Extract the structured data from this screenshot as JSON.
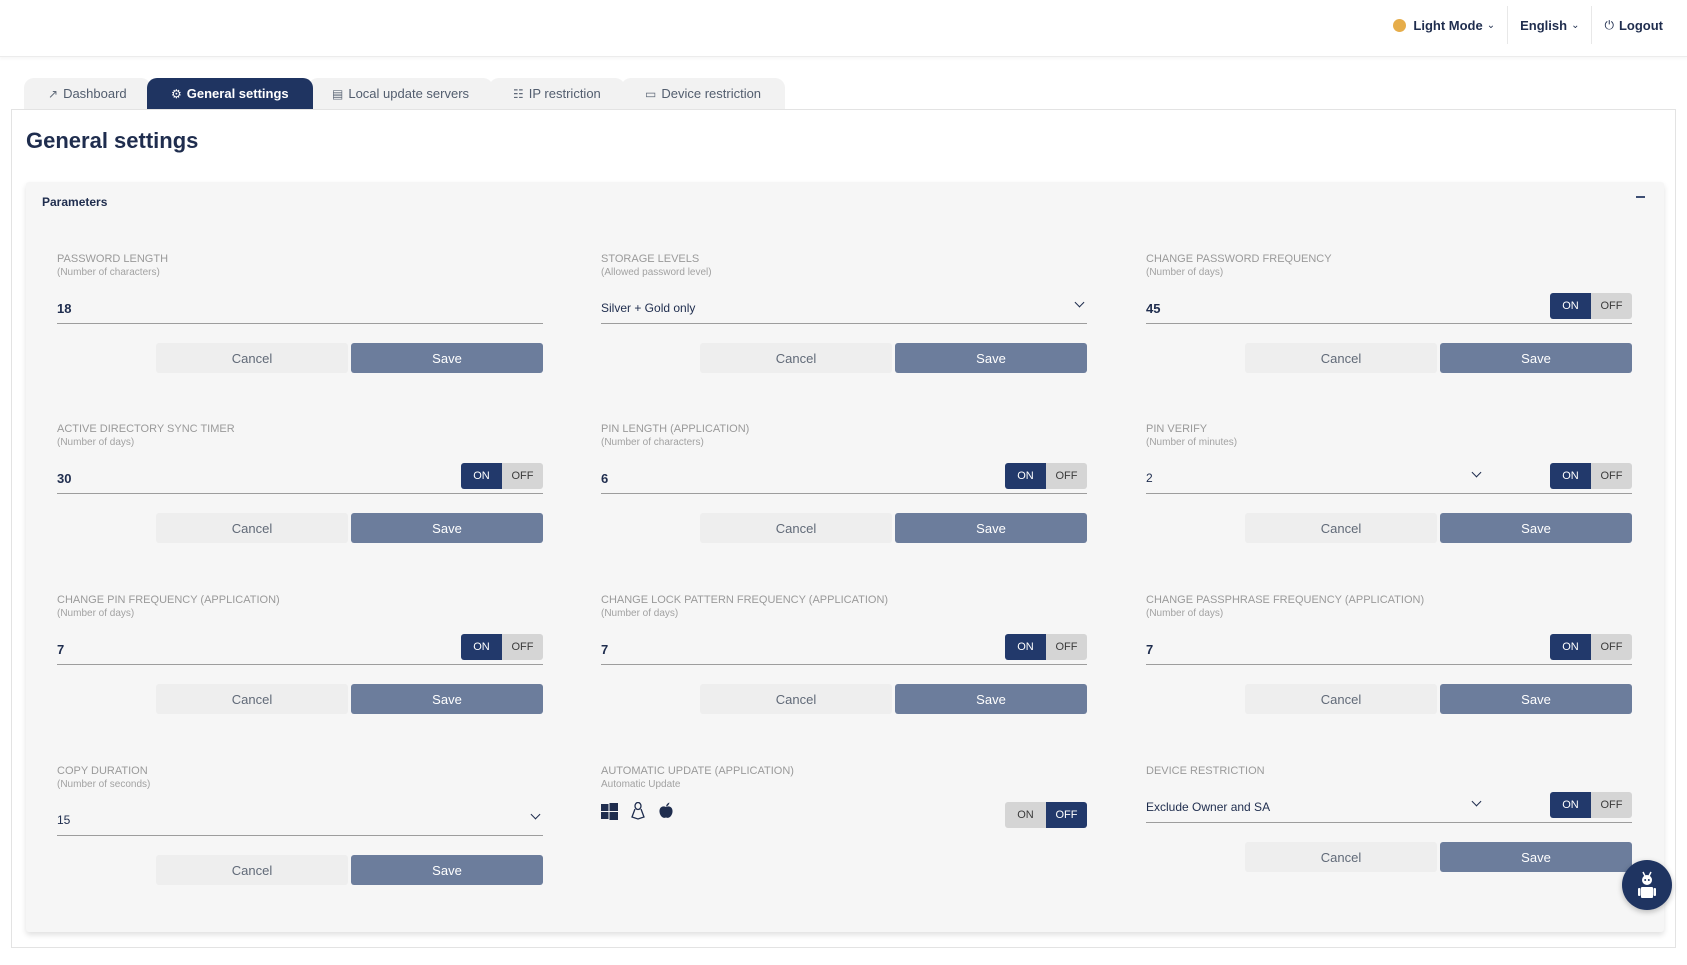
{
  "topbar": {
    "mode_label": "Light Mode",
    "mode_color": "#e6ad4a",
    "language_label": "English",
    "logout_label": "Logout"
  },
  "tabs": [
    {
      "label": "Dashboard",
      "icon": "chart-line-icon",
      "active": false
    },
    {
      "label": "General settings",
      "icon": "gear-icon",
      "active": true
    },
    {
      "label": "Local update servers",
      "icon": "server-icon",
      "active": false
    },
    {
      "label": "IP restriction",
      "icon": "network-icon",
      "active": false
    },
    {
      "label": "Device restriction",
      "icon": "monitor-icon",
      "active": false
    }
  ],
  "page": {
    "title": "General settings",
    "panel_title": "Parameters"
  },
  "buttons": {
    "cancel": "Cancel",
    "save": "Save"
  },
  "toggle_labels": {
    "on": "ON",
    "off": "OFF"
  },
  "fields": [
    {
      "label": "PASSWORD LENGTH",
      "sub": "(Number of characters)",
      "value": "18",
      "type": "text",
      "toggle": null
    },
    {
      "label": "STORAGE LEVELS",
      "sub": "(Allowed password level)",
      "value": "Silver + Gold only",
      "type": "select",
      "toggle": null
    },
    {
      "label": "CHANGE PASSWORD FREQUENCY",
      "sub": "(Number of days)",
      "value": "45",
      "type": "text",
      "toggle": "on"
    },
    {
      "label": "ACTIVE DIRECTORY SYNC TIMER",
      "sub": "(Number of days)",
      "value": "30",
      "type": "text",
      "toggle": "on"
    },
    {
      "label": "PIN LENGTH (APPLICATION)",
      "sub": "(Number of characters)",
      "value": "6",
      "type": "text",
      "toggle": "on"
    },
    {
      "label": "PIN VERIFY",
      "sub": "(Number of minutes)",
      "value": "2",
      "type": "select",
      "toggle": "on"
    },
    {
      "label": "CHANGE PIN FREQUENCY (APPLICATION)",
      "sub": "(Number of days)",
      "value": "7",
      "type": "text",
      "toggle": "on"
    },
    {
      "label": "CHANGE LOCK PATTERN FREQUENCY (APPLICATION)",
      "sub": "(Number of days)",
      "value": "7",
      "type": "text",
      "toggle": "on"
    },
    {
      "label": "CHANGE PASSPHRASE FREQUENCY (APPLICATION)",
      "sub": "(Number of days)",
      "value": "7",
      "type": "text",
      "toggle": "on"
    },
    {
      "label": "COPY DURATION",
      "sub": "(Number of seconds)",
      "value": "15",
      "type": "select",
      "toggle": null
    },
    {
      "label": "AUTOMATIC UPDATE (APPLICATION)",
      "sub": "Automatic Update",
      "value": "",
      "type": "os",
      "toggle": "off",
      "os_icons": [
        "windows-icon",
        "linux-icon",
        "apple-icon"
      ]
    },
    {
      "label": "DEVICE RESTRICTION",
      "sub": "",
      "value": "Exclude Owner and SA",
      "type": "select",
      "toggle": "on"
    }
  ],
  "colors": {
    "accent": "#22396b",
    "save_button": "#6c7d9c",
    "panel_bg": "#f6f6f6"
  }
}
